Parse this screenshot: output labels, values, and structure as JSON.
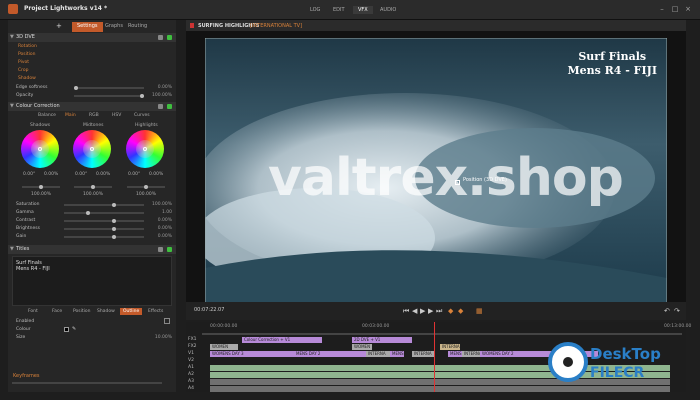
{
  "app": {
    "title": "Project Lightworks v14 *",
    "tabs": [
      "LOG",
      "EDIT",
      "VFX",
      "AUDIO"
    ],
    "active_tab": "VFX"
  },
  "left": {
    "add": "+",
    "subtabs": [
      "Settings",
      "Graphs",
      "Routing"
    ],
    "dve": {
      "header": "3D DVE",
      "items": [
        "Rotation",
        "Position",
        "Pivot",
        "Crop",
        "Shadow"
      ]
    },
    "edge_softness": {
      "label": "Edge softness",
      "value": "0.00%"
    },
    "opacity": {
      "label": "Opacity",
      "value": "100.00%"
    },
    "cc": {
      "header": "Colour Correction",
      "tabs": [
        "Balance",
        "Main",
        "RGB",
        "HSV",
        "Curves"
      ],
      "wheels": [
        {
          "name": "Shadows",
          "v1": "0.00°",
          "v2": "0.00%",
          "v3": "100.00%"
        },
        {
          "name": "Midtones",
          "v1": "0.00°",
          "v2": "0.00%",
          "v3": "100.00%"
        },
        {
          "name": "Highlights",
          "v1": "0.00°",
          "v2": "0.00%",
          "v3": "100.00%"
        }
      ],
      "props": [
        {
          "label": "Saturation",
          "value": "100.00%"
        },
        {
          "label": "Gamma",
          "value": "1.00"
        },
        {
          "label": "Contrast",
          "value": "0.00%"
        },
        {
          "label": "Brightness",
          "value": "0.00%"
        },
        {
          "label": "Gain",
          "value": "0.00%"
        }
      ]
    },
    "titles": {
      "header": "Titles",
      "line1": "Surf Finals",
      "line2": "Mens R4 - FIJI"
    },
    "font_tabs": [
      "Font",
      "Face",
      "Position",
      "Shadow",
      "Outline",
      "Effects"
    ],
    "enabled_label": "Enabled",
    "colour_label": "Colour",
    "size_label": "Size",
    "size_value": "10.00%",
    "keyframes_label": "Keyframes"
  },
  "viewer": {
    "title": "SURFING HIGHLIGHTS",
    "subtitle": "[INTERNATIONAL TV]",
    "overlay_line1": "Surf Finals",
    "overlay_line2": "Mens R4 - FIJI",
    "position_label": "Position (3D DVE)",
    "timecode": "00:07:22.07",
    "watermark": "valtrex.shop"
  },
  "timeline": {
    "times": [
      "00:00:00.00",
      "00:03:00.00",
      "00:13:00.00"
    ],
    "tracks": [
      "FX1",
      "FX2",
      "V1",
      "V2",
      "A1",
      "A2",
      "A3",
      "A4"
    ],
    "clips": [
      "Colour Correction + V1",
      "2D DVE + V1",
      "WOMEN",
      "INTERNA",
      "WOMENS DAY 3",
      "INTERNA",
      "MENS DAY 2",
      "INTERNA",
      "MENS",
      "INTERNA",
      "WOMENS DAY 2",
      "INTERNA",
      "MENS DAY 3",
      "WOMENS DAY 2",
      "MENS DAY 2"
    ]
  },
  "logo": {
    "line1": "DeskTop",
    "line2": "FILECR"
  }
}
